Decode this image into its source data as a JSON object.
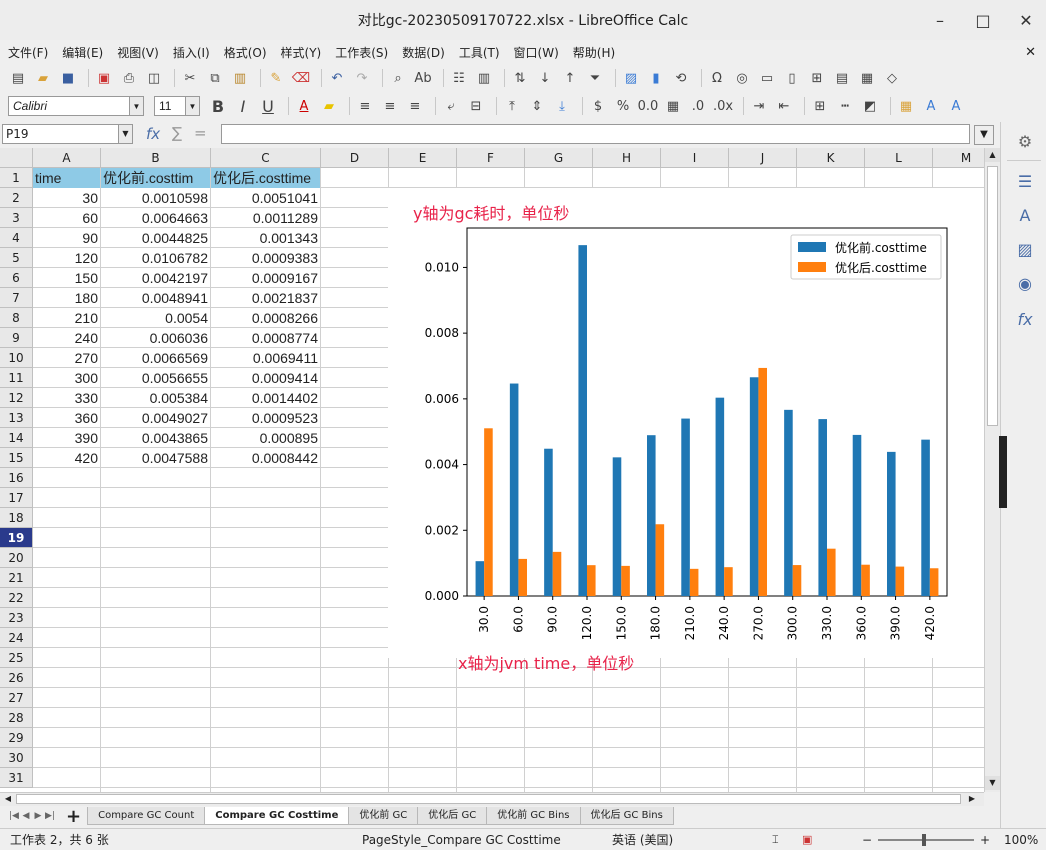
{
  "window": {
    "title": "对比gc-20230509170722.xlsx - LibreOffice Calc",
    "minimize": "–",
    "maximize": "□",
    "close": "✕"
  },
  "menu": [
    "文件(F)",
    "编辑(E)",
    "视图(V)",
    "插入(I)",
    "格式(O)",
    "样式(Y)",
    "工作表(S)",
    "数据(D)",
    "工具(T)",
    "窗口(W)",
    "帮助(H)"
  ],
  "toolbar2": {
    "font_name": "Calibri",
    "font_size": "11"
  },
  "formula_bar": {
    "cell_ref": "P19",
    "fx": "fx",
    "sum": "∑",
    "equals": "=",
    "content": ""
  },
  "columns": [
    "A",
    "B",
    "C",
    "D",
    "E",
    "F",
    "G",
    "H",
    "I",
    "J",
    "K",
    "L",
    "M"
  ],
  "rows": [
    "1",
    "2",
    "3",
    "4",
    "5",
    "6",
    "7",
    "8",
    "9",
    "10",
    "11",
    "12",
    "13",
    "14",
    "15",
    "16",
    "17",
    "18",
    "19",
    "20",
    "21",
    "22",
    "23",
    "24",
    "25",
    "26",
    "27",
    "28",
    "29",
    "30",
    "31"
  ],
  "active_row": "19",
  "table": {
    "headers": [
      "time",
      "优化前.costtim",
      "优化后.costtime"
    ],
    "data": [
      [
        "30",
        "0.0010598",
        "0.0051041"
      ],
      [
        "60",
        "0.0064663",
        "0.0011289"
      ],
      [
        "90",
        "0.0044825",
        "0.001343"
      ],
      [
        "120",
        "0.0106782",
        "0.0009383"
      ],
      [
        "150",
        "0.0042197",
        "0.0009167"
      ],
      [
        "180",
        "0.0048941",
        "0.0021837"
      ],
      [
        "210",
        "0.0054",
        "0.0008266"
      ],
      [
        "240",
        "0.006036",
        "0.0008774"
      ],
      [
        "270",
        "0.0066569",
        "0.0069411"
      ],
      [
        "300",
        "0.0056655",
        "0.0009414"
      ],
      [
        "330",
        "0.005384",
        "0.0014402"
      ],
      [
        "360",
        "0.0049027",
        "0.0009523"
      ],
      [
        "390",
        "0.0043865",
        "0.000895"
      ],
      [
        "420",
        "0.0047588",
        "0.0008442"
      ]
    ]
  },
  "annotations": {
    "y_note": "y轴为gc耗时，单位秒",
    "x_note": "x轴为jvm time，单位秒"
  },
  "chart_data": {
    "type": "bar",
    "categories": [
      "30.0",
      "60.0",
      "90.0",
      "120.0",
      "150.0",
      "180.0",
      "210.0",
      "240.0",
      "270.0",
      "300.0",
      "330.0",
      "360.0",
      "390.0",
      "420.0"
    ],
    "series": [
      {
        "name": "优化前.costtime",
        "color": "#1f77b4",
        "values": [
          0.0010598,
          0.0064663,
          0.0044825,
          0.0106782,
          0.0042197,
          0.0048941,
          0.0054,
          0.006036,
          0.0066569,
          0.0056655,
          0.005384,
          0.0049027,
          0.0043865,
          0.0047588
        ]
      },
      {
        "name": "优化后.costtime",
        "color": "#ff7f0e",
        "values": [
          0.0051041,
          0.0011289,
          0.001343,
          0.0009383,
          0.0009167,
          0.0021837,
          0.0008266,
          0.0008774,
          0.0069411,
          0.0009414,
          0.0014402,
          0.0009523,
          0.000895,
          0.0008442
        ]
      }
    ],
    "yticks": [
      "0.000",
      "0.002",
      "0.004",
      "0.006",
      "0.008",
      "0.010"
    ],
    "ylim": [
      0,
      0.0112
    ],
    "legend": "top-right"
  },
  "sheet_tabs": [
    "Compare GC Count",
    "Compare GC Costtime",
    "优化前 GC",
    "优化后 GC",
    "优化前 GC Bins",
    "优化后 GC Bins"
  ],
  "active_tab": "Compare GC Costtime",
  "add_tab": "+",
  "status": {
    "sheet_info": "工作表 2，共 6 张",
    "page_style": "PageStyle_Compare GC Costtime",
    "language": "英语 (美国)",
    "zoom_minus": "−",
    "zoom_plus": "+",
    "zoom": "100%"
  }
}
